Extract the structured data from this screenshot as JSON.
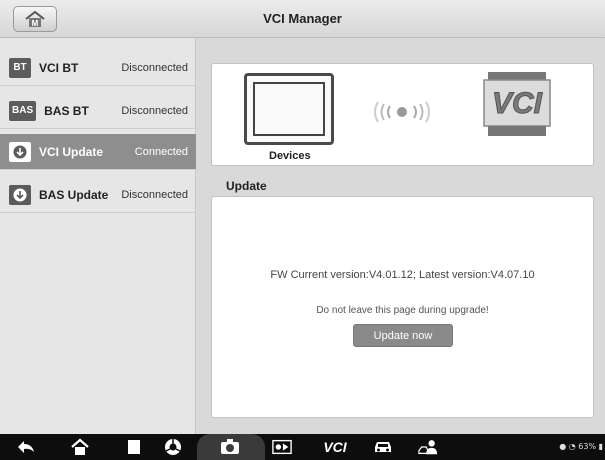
{
  "header": {
    "title": "VCI Manager",
    "home_icon": "home-icon"
  },
  "sidebar": {
    "items": [
      {
        "badge": "BT",
        "label": "VCI BT",
        "status": "Disconnected",
        "active": false
      },
      {
        "badge": "BAS",
        "label": "BAS BT",
        "status": "Disconnected",
        "active": false
      },
      {
        "badge": "",
        "label": "VCI Update",
        "status": "Connected",
        "active": true,
        "icon": "download-icon"
      },
      {
        "badge": "",
        "label": "BAS Update",
        "status": "Disconnected",
        "active": false,
        "icon": "download-icon"
      }
    ]
  },
  "devices": {
    "label": "Devices",
    "logo_text": "VCI"
  },
  "update": {
    "title": "Update",
    "fw_text": "FW Current version:V4.01.12; Latest version:V4.07.10",
    "warning": "Do not leave this page during upgrade!",
    "button_label": "Update now"
  },
  "navbar": {
    "icons": [
      "back-icon",
      "home-icon",
      "recent-apps-icon",
      "chrome-icon",
      "camera-icon",
      "screen-capture-icon",
      "vci-icon",
      "car-icon",
      "remote-expert-icon"
    ],
    "vci_text": "VCI",
    "status": "63%"
  },
  "colors": {
    "active": "#8e8e8e",
    "button": "#8a8a8a",
    "navbar": "#0d0d0d"
  }
}
